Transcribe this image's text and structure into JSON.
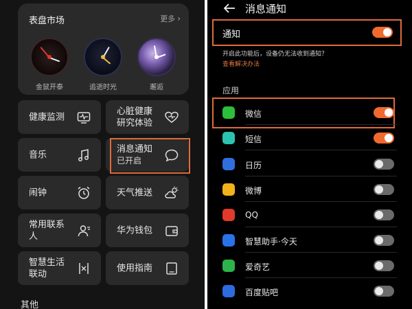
{
  "left": {
    "watch_market": {
      "title": "表盘市场",
      "more_label": "更多",
      "faces": [
        {
          "name": "金鼠开泰"
        },
        {
          "name": "追逝时光"
        },
        {
          "name": "邂逅"
        }
      ]
    },
    "tiles": {
      "health": "健康监测",
      "heart_line1": "心脏健康",
      "heart_line2": "研究体验",
      "music": "音乐",
      "notif_line1": "消息通知",
      "notif_line2": "已开启",
      "alarm": "闹钟",
      "weather": "天气推送",
      "contacts_line1": "常用联系",
      "contacts_line2": "人",
      "wallet": "华为钱包",
      "smartlife_line1": "智慧生活",
      "smartlife_line2": "联动",
      "guide": "使用指南"
    },
    "other_section": "其他"
  },
  "right": {
    "title": "消息通知",
    "notification_label": "通知",
    "notification_on": true,
    "warning_text": "开启此功能后，设备仍无法收到通知？",
    "fix_link": "查看解决办法",
    "apps_section": "应用",
    "apps": [
      {
        "name": "微信",
        "on": true,
        "icon": "wechat-icon",
        "color": "#2dbe3c"
      },
      {
        "name": "短信",
        "on": true,
        "icon": "sms-icon",
        "color": "#2bc3b0"
      },
      {
        "name": "日历",
        "on": false,
        "icon": "calendar-icon",
        "color": "#2f6fe0"
      },
      {
        "name": "微博",
        "on": false,
        "icon": "weibo-icon",
        "color": "#f2b21a"
      },
      {
        "name": "QQ",
        "on": false,
        "icon": "qq-icon",
        "color": "#e03a2a"
      },
      {
        "name": "智慧助手·今天",
        "on": false,
        "icon": "assistant-icon",
        "color": "#2a72e8"
      },
      {
        "name": "爱奇艺",
        "on": false,
        "icon": "iqiyi-icon",
        "color": "#2cb34a"
      },
      {
        "name": "百度贴吧",
        "on": false,
        "icon": "tieba-icon",
        "color": "#2d6be0"
      }
    ]
  },
  "colors": {
    "accent": "#f06a30",
    "highlight_border": "#e06b3a",
    "tile_bg": "#2a2a2a"
  }
}
